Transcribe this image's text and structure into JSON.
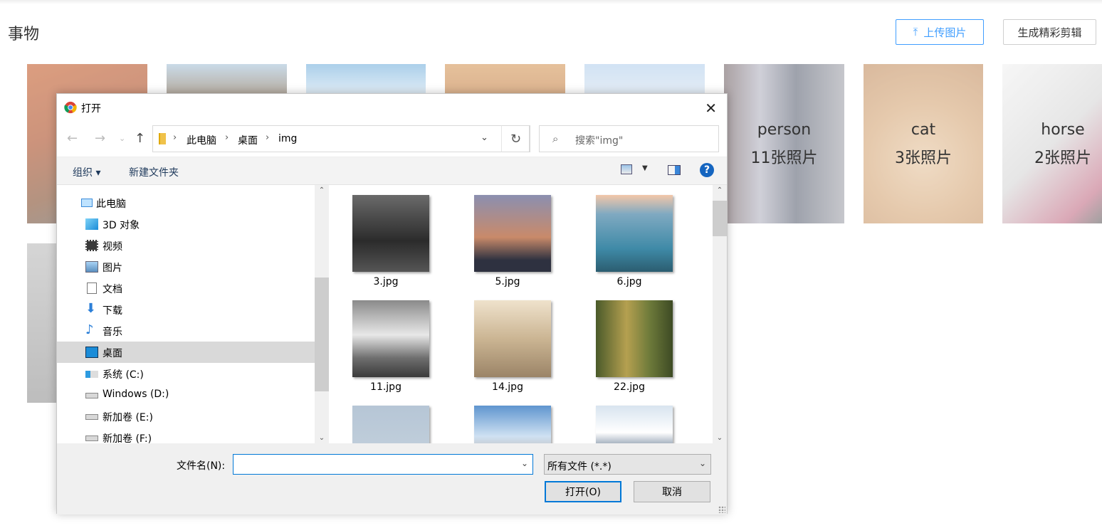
{
  "page": {
    "title": "事物",
    "upload_label": "上传图片",
    "highlight_label": "生成精彩剪辑"
  },
  "tiles": [
    {
      "name": "person",
      "count": "11张照片"
    },
    {
      "name": "cat",
      "count": "3张照片"
    },
    {
      "name": "horse",
      "count": "2张照片"
    }
  ],
  "dialog": {
    "title": "打开",
    "breadcrumb": [
      "此电脑",
      "桌面",
      "img"
    ],
    "search_placeholder": "搜索\"img\"",
    "toolbar": {
      "organize": "组织 ▾",
      "new_folder": "新建文件夹"
    },
    "nav_items": [
      {
        "label": "此电脑",
        "icon": "computer-icon"
      },
      {
        "label": "3D 对象",
        "icon": "3d-objects-icon"
      },
      {
        "label": "视频",
        "icon": "video-icon"
      },
      {
        "label": "图片",
        "icon": "pictures-icon"
      },
      {
        "label": "文档",
        "icon": "documents-icon"
      },
      {
        "label": "下载",
        "icon": "download-icon"
      },
      {
        "label": "音乐",
        "icon": "music-icon"
      },
      {
        "label": "桌面",
        "icon": "desktop-icon",
        "selected": true
      },
      {
        "label": "系统 (C:)",
        "icon": "system-drive-icon"
      },
      {
        "label": "Windows (D:)",
        "icon": "drive-icon"
      },
      {
        "label": "新加卷 (E:)",
        "icon": "drive-icon"
      },
      {
        "label": "新加卷 (F:)",
        "icon": "drive-icon"
      }
    ],
    "files": [
      "3.jpg",
      "5.jpg",
      "6.jpg",
      "11.jpg",
      "14.jpg",
      "22.jpg",
      "",
      "",
      ""
    ],
    "filename_label": "文件名(N):",
    "filename_value": "",
    "filetype_value": "所有文件 (*.*)",
    "open_label": "打开(O)",
    "cancel_label": "取消"
  },
  "colors": {
    "accent": "#409eff",
    "selection": "#d9d9d9",
    "focus": "#0078d7"
  }
}
